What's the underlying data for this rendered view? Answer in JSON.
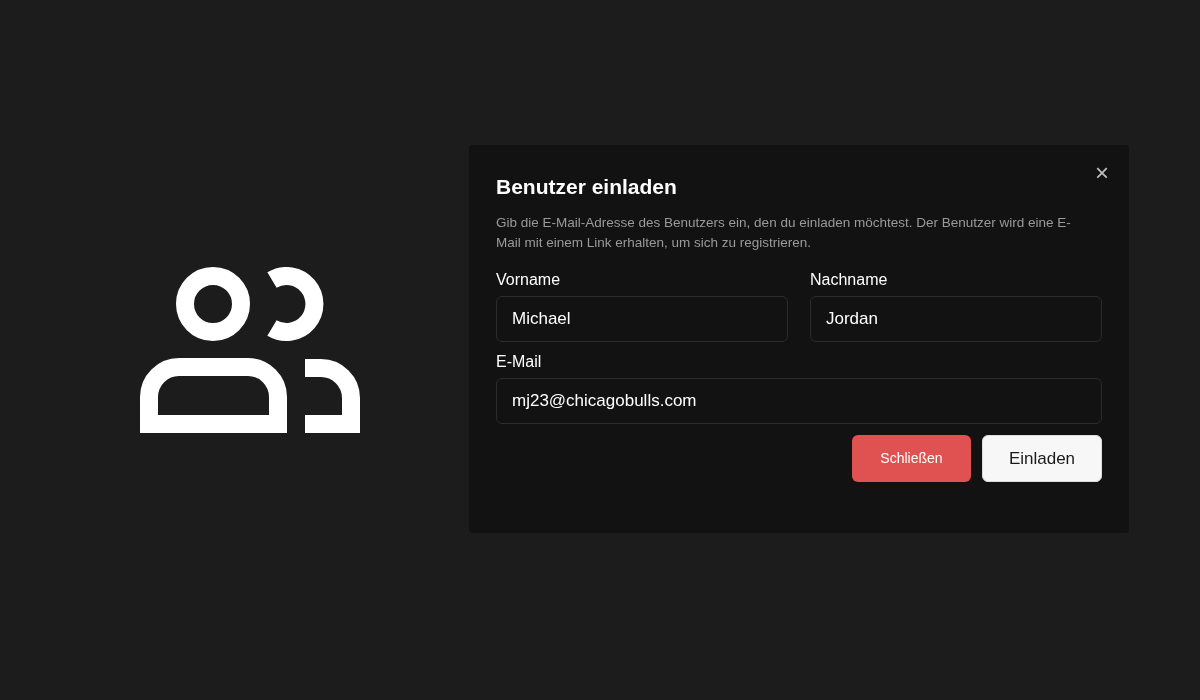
{
  "dialog": {
    "title": "Benutzer einladen",
    "close": "×",
    "description": "Gib die E-Mail-Adresse des Benutzers ein, den du einladen möchtest. Der Benutzer wird eine E-Mail mit einem Link erhalten, um sich zu registrieren.",
    "fields": [
      {
        "label": "Vorname",
        "value": "Michael"
      },
      {
        "label": "Nachname",
        "value": "Jordan"
      },
      {
        "label": "E-Mail",
        "value": "mj23@chicagobulls.com"
      }
    ],
    "buttons": [
      {
        "label": "Schließen",
        "kind": "danger"
      },
      {
        "label": "Einladen",
        "kind": "primary"
      }
    ]
  }
}
